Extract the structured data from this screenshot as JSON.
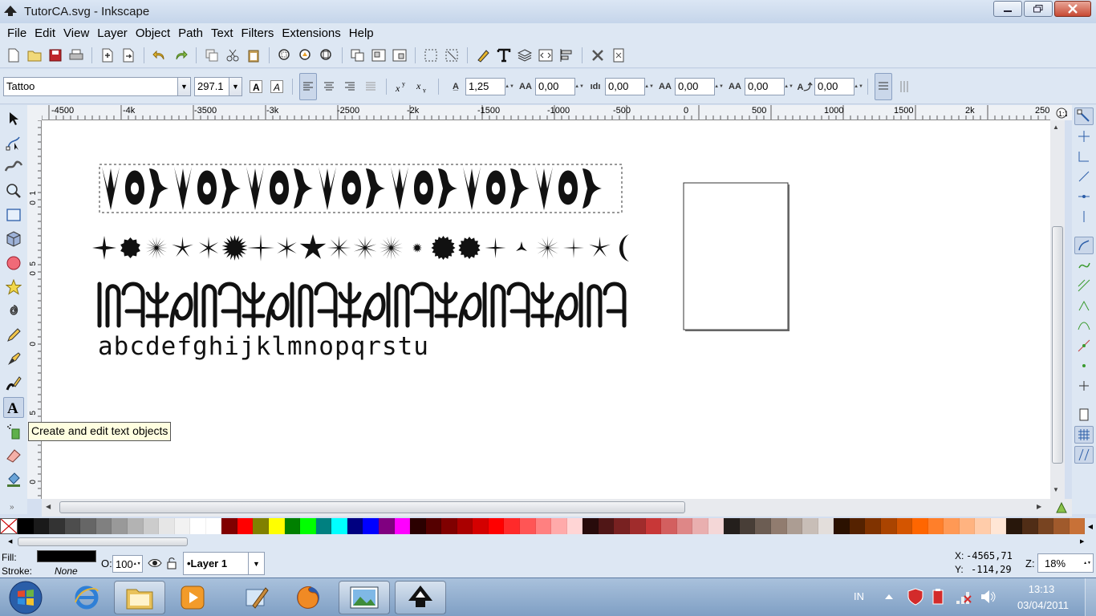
{
  "window": {
    "title": "TutorCA.svg - Inkscape",
    "minimize_label": "—",
    "maximize_label": "❐",
    "close_label": "✕"
  },
  "menu": {
    "items": [
      {
        "label": "File"
      },
      {
        "label": "Edit"
      },
      {
        "label": "View"
      },
      {
        "label": "Layer"
      },
      {
        "label": "Object"
      },
      {
        "label": "Path"
      },
      {
        "label": "Text"
      },
      {
        "label": "Filters"
      },
      {
        "label": "Extensions"
      },
      {
        "label": "Help"
      }
    ]
  },
  "text_toolbar": {
    "font_family": "Tattoo",
    "font_size": "297.1",
    "line_spacing": "1,25",
    "letter_spacing": "0,00",
    "word_spacing": "0,00",
    "kerning": "0,00",
    "vertical_shift": "0,00",
    "rotation": "0,00"
  },
  "rulers": {
    "horizontal": [
      "-4500",
      "-4k",
      "-3500",
      "-3k",
      "-2500",
      "-2k",
      "-1500",
      "-1000",
      "-500",
      "0",
      "500",
      "1000",
      "1500",
      "2k",
      "250"
    ],
    "vertical": [
      "1",
      "0",
      "5",
      "0",
      "0",
      "5",
      "0"
    ]
  },
  "canvas": {
    "alphabet_text": "abcdefghijklmnopqrstu"
  },
  "tooltip": {
    "text": "Create and edit text objects"
  },
  "palette": {
    "colors": [
      "#000000",
      "#1a1a1a",
      "#333333",
      "#4d4d4d",
      "#666666",
      "#808080",
      "#999999",
      "#b3b3b3",
      "#cccccc",
      "#e6e6e6",
      "#f2f2f2",
      "#ffffff",
      "#ffffff",
      "#800000",
      "#ff0000",
      "#808000",
      "#ffff00",
      "#008000",
      "#00ff00",
      "#008080",
      "#00ffff",
      "#000080",
      "#0000ff",
      "#800080",
      "#ff00ff",
      "#2b0000",
      "#550000",
      "#800000",
      "#aa0000",
      "#d40000",
      "#ff0000",
      "#ff2a2a",
      "#ff5555",
      "#ff8080",
      "#ffaaaa",
      "#ffd5d5",
      "#280b0b",
      "#501616",
      "#782121",
      "#a02c2c",
      "#c83737",
      "#d35f5f",
      "#de8787",
      "#e9afaf",
      "#f4d7d7",
      "#241f1c",
      "#483e37",
      "#6c5d53",
      "#917c6f",
      "#ac9d93",
      "#c8beb7",
      "#e3dedb",
      "#2b1100",
      "#552200",
      "#803300",
      "#aa4400",
      "#d45500",
      "#ff6600",
      "#ff7f2a",
      "#ff9955",
      "#ffb380",
      "#ffccaa",
      "#ffe6d5",
      "#28170b",
      "#502d16",
      "#784421",
      "#a05a2c",
      "#c87137"
    ]
  },
  "status": {
    "fill_label": "Fill:",
    "stroke_label": "Stroke:",
    "stroke_value": "None",
    "fill_color": "#000000",
    "opacity_label": "O:",
    "opacity_value": "100",
    "layer_name": "•Layer 1",
    "x_label": "X:",
    "x_value": "-4565,71",
    "y_label": "Y:",
    "y_value": "-114,29",
    "zoom_label": "Z:",
    "zoom_value": "18%"
  },
  "taskbar": {
    "language": "IN",
    "time": "13:13",
    "date": "03/04/2011"
  }
}
